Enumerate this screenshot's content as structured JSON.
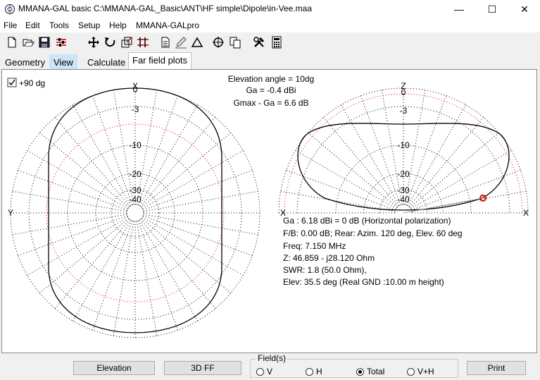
{
  "window": {
    "title": "MMANA-GAL basic C:\\MMANA-GAL_Basic\\ANT\\HF simple\\Dipole\\in-Vee.maa",
    "minimize": "—",
    "maximize": "☐",
    "close": "✕"
  },
  "menu": [
    "File",
    "Edit",
    "Tools",
    "Setup",
    "Help",
    "MMANA-GALpro"
  ],
  "toolbar_icons": [
    "new-file-icon",
    "open-folder-icon",
    "save-icon",
    "sliders-icon",
    "move-icon",
    "rotate-icon",
    "stretch-icon",
    "wires-icon",
    "document-icon",
    "pen-icon",
    "triangle-icon",
    "target-icon",
    "copy-icon",
    "tools-icon",
    "calculator-icon"
  ],
  "tabs": [
    "Geometry",
    "View",
    "Calculate",
    "Far field plots"
  ],
  "plot": {
    "checkbox_label": "+90 dg",
    "elevation_angle": "Elevation angle =  10dg",
    "ga": "Ga = -0.4 dBi",
    "gmax_ga": "Gmax - Ga = 6.6 dB",
    "left_top_axis": "X",
    "left_side_axis": "Y",
    "right_top_axis": "Z",
    "right_side_axis_left": "X",
    "right_side_axis_right": "X",
    "scale_labels": [
      "0",
      "-3",
      "-10",
      "-20",
      "-30",
      "-40"
    ]
  },
  "info": {
    "line1": "Ga : 6.18 dBi = 0 dB  (Horizontal polarization)",
    "line2": "F/B: 0.00 dB; Rear: Azim. 120 deg,  Elev. 60 deg",
    "line3": "Freq: 7.150 MHz",
    "line4": "Z: 46.859 - j28.120 Ohm",
    "line5": "SWR: 1.8 (50.0 Ohm),",
    "line6": "Elev: 35.5 deg (Real GND  :10.00 m height)"
  },
  "bottom": {
    "elevation_button": "Elevation",
    "ff3d_button": "3D FF",
    "fields_legend": "Field(s)",
    "radio_v": "V",
    "radio_h": "H",
    "radio_total": "Total",
    "radio_vh": "V+H",
    "selected": "Total",
    "print_button": "Print"
  },
  "colors": {
    "pattern": "#000000",
    "ref_circle": "#e00000",
    "marker": "#e00000"
  }
}
